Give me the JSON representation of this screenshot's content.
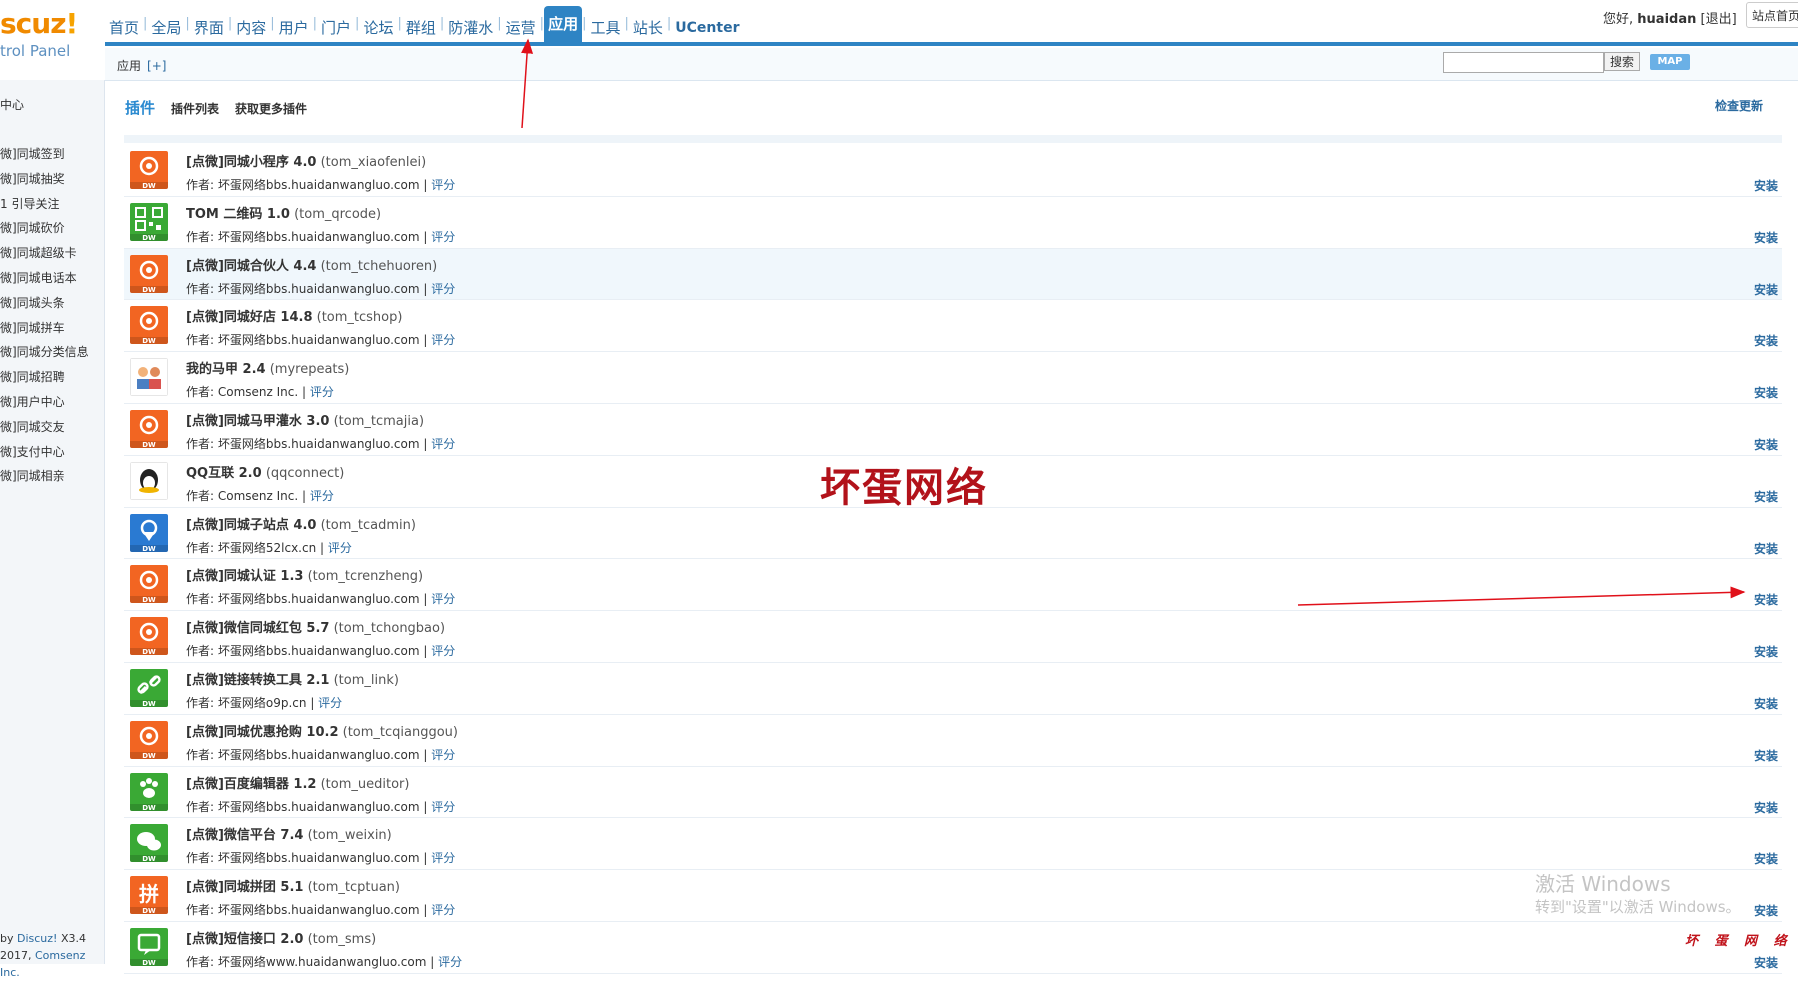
{
  "logo": {
    "brand": "scuz",
    "bang": "!",
    "subtitle": "trol Panel"
  },
  "topnav": [
    {
      "label": "首页"
    },
    {
      "label": "全局"
    },
    {
      "label": "界面"
    },
    {
      "label": "内容"
    },
    {
      "label": "用户"
    },
    {
      "label": "门户"
    },
    {
      "label": "论坛"
    },
    {
      "label": "群组"
    },
    {
      "label": "防灌水"
    },
    {
      "label": "运营"
    },
    {
      "label": "应用",
      "active": true
    },
    {
      "label": "工具"
    },
    {
      "label": "站长"
    },
    {
      "label": "UCenter"
    }
  ],
  "user": {
    "greeting": "您好,",
    "name": "huaidan",
    "logout": "[退出]",
    "site_home": "站点首页"
  },
  "subbar": {
    "crumb": "应用",
    "add": "[+]",
    "search_button": "搜索",
    "map_button": "MAP"
  },
  "sidebar": {
    "top": "中心",
    "items": [
      "微]同城签到",
      "微]同城抽奖",
      "1 引导关注",
      "微]同城砍价",
      "微]同城超级卡",
      "微]同城电话本",
      "微]同城头条",
      "微]同城拼车",
      "微]同城分类信息",
      "微]同城招聘",
      "微]用户中心",
      "微]同城交友",
      "微]支付中心",
      "微]同城相亲"
    ],
    "copy_prefix": "by",
    "copy_link": "Discuz!",
    "copy_version": "X3.4",
    "copy_year": "2017,",
    "copy_company": "Comsenz Inc."
  },
  "tabs": [
    {
      "label": "插件",
      "active": true
    },
    {
      "label": "插件列表"
    },
    {
      "label": "获取更多插件"
    }
  ],
  "check_update": "检查更新",
  "author_label": "作者:",
  "rate_label": "评分",
  "install_label": "安装",
  "plugins": [
    {
      "title": "[点微]同城小程序 4.0",
      "ident": "(tom_xiaofenlei)",
      "author": "坏蛋网络bbs.huaidanwangluo.com",
      "icon": "mini-program-icon",
      "color": "#f26522"
    },
    {
      "title": "TOM 二维码 1.0",
      "ident": "(tom_qrcode)",
      "author": "坏蛋网络bbs.huaidanwangluo.com",
      "icon": "qrcode-icon",
      "color": "#3aa935"
    },
    {
      "title": "[点微]同城合伙人 4.4",
      "ident": "(tom_tchehuoren)",
      "author": "坏蛋网络bbs.huaidanwangluo.com",
      "icon": "partner-icon",
      "color": "#f26522",
      "highlight": true
    },
    {
      "title": "[点微]同城好店 14.8",
      "ident": "(tom_tcshop)",
      "author": "坏蛋网络bbs.huaidanwangluo.com",
      "icon": "shop-icon",
      "color": "#f26522"
    },
    {
      "title": "我的马甲 2.4",
      "ident": "(myrepeats)",
      "author": "Comsenz Inc.",
      "icon": "users-icon",
      "color": "#ffffff"
    },
    {
      "title": "[点微]同城马甲灌水 3.0",
      "ident": "(tom_tcmajia)",
      "author": "坏蛋网络bbs.huaidanwangluo.com",
      "icon": "group-icon",
      "color": "#f26522"
    },
    {
      "title": "QQ互联 2.0",
      "ident": "(qqconnect)",
      "author": "Comsenz Inc.",
      "icon": "qq-icon",
      "color": "#ffffff"
    },
    {
      "title": "[点微]同城子站点 4.0",
      "ident": "(tom_tcadmin)",
      "author": "坏蛋网络52lcx.cn",
      "icon": "location-icon",
      "color": "#2a7ad2"
    },
    {
      "title": "[点微]同城认证 1.3",
      "ident": "(tom_tcrenzheng)",
      "author": "坏蛋网络bbs.huaidanwangluo.com",
      "icon": "verify-icon",
      "color": "#f26522"
    },
    {
      "title": "[点微]微信同城红包 5.7",
      "ident": "(tom_tchongbao)",
      "author": "坏蛋网络bbs.huaidanwangluo.com",
      "icon": "redpacket-icon",
      "color": "#f26522"
    },
    {
      "title": "[点微]链接转换工具 2.1",
      "ident": "(tom_link)",
      "author": "坏蛋网络o9p.cn",
      "icon": "link-icon",
      "color": "#3aa935"
    },
    {
      "title": "[点微]同城优惠抢购 10.2",
      "ident": "(tom_tcqianggou)",
      "author": "坏蛋网络bbs.huaidanwangluo.com",
      "icon": "flash-sale-icon",
      "color": "#f26522"
    },
    {
      "title": "[点微]百度编辑器 1.2",
      "ident": "(tom_ueditor)",
      "author": "坏蛋网络bbs.huaidanwangluo.com",
      "icon": "paw-icon",
      "color": "#3aa935"
    },
    {
      "title": "[点微]微信平台 7.4",
      "ident": "(tom_weixin)",
      "author": "坏蛋网络bbs.huaidanwangluo.com",
      "icon": "wechat-icon",
      "color": "#3aa935"
    },
    {
      "title": "[点微]同城拼团 5.1",
      "ident": "(tom_tcptuan)",
      "author": "坏蛋网络bbs.huaidanwangluo.com",
      "icon": "groupbuy-icon",
      "color": "#f26522"
    },
    {
      "title": "[点微]短信接口 2.0",
      "ident": "(tom_sms)",
      "author": "坏蛋网络www.huaidanwangluo.com",
      "icon": "sms-icon",
      "color": "#3aa935"
    }
  ],
  "watermark": "坏蛋网络",
  "windows": {
    "line1": "激活 Windows",
    "line2": "转到\"设置\"以激活 Windows。"
  },
  "stamp": "坏 蛋 网 络"
}
